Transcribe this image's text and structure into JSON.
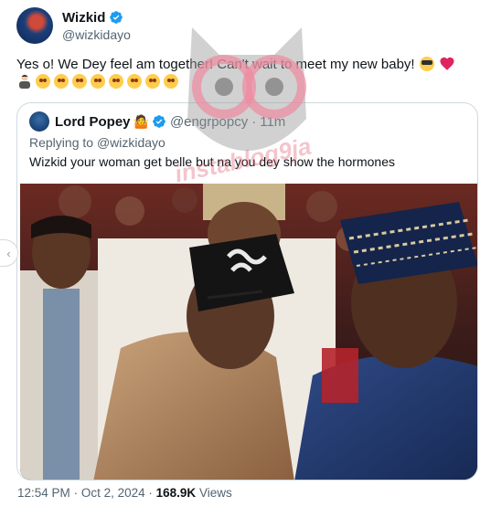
{
  "author": {
    "display_name": "Wizkid",
    "handle": "@wizkidayo",
    "verified": true
  },
  "tweet": {
    "text": "Yes o! We Dey feel am together! Can't wait to meet my new baby!",
    "emojis": [
      "smiling-face-with-sunglasses",
      "red-heart",
      "man-tipping-hand",
      "smiling-face",
      "smiling-face",
      "smiling-face",
      "smiling-face",
      "smiling-face",
      "smiling-face",
      "smiling-face",
      "smiling-face"
    ]
  },
  "quoted": {
    "display_name": "Lord Popey",
    "badge_emoji": "🤷",
    "handle": "@engrpopcy",
    "time": "11m",
    "reply_prefix": "Replying to",
    "reply_handle": "@wizkidayo",
    "text": "Wizkid your woman get belle but na you dey show the hormones"
  },
  "meta": {
    "time": "12:54 PM",
    "date": "Oct 2, 2024",
    "views_count": "168.9K",
    "views_label": "Views"
  },
  "watermark": {
    "text": "instablog9ja"
  },
  "colors": {
    "text": "#0f1419",
    "muted": "#536471",
    "border": "#cfd9de",
    "verified": "#1d9bf0",
    "heart": "#e0245e"
  }
}
